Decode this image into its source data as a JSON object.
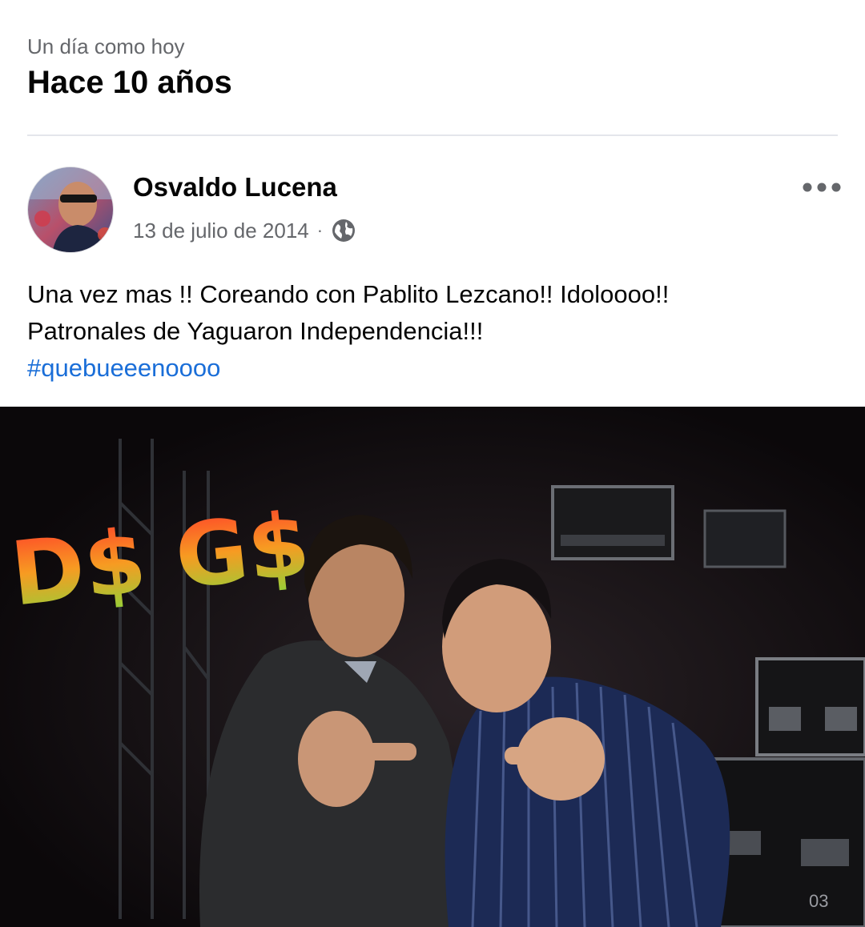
{
  "memory": {
    "eyebrow": "Un día como hoy",
    "title": "Hace 10 años"
  },
  "post": {
    "author": "Osvaldo Lucena",
    "date": "13 de julio de 2014",
    "separator": "·",
    "privacy_icon": "globe-icon",
    "more_icon": "more-options-icon",
    "text_line1": "Una vez mas !! Coreando con Pablito Lezcano!! Idoloooo!!",
    "text_line2": "Patronales de Yaguaron Independencia!!!",
    "hashtag": "#quebueeenoooo",
    "photo_overlay_text": "D$ G$",
    "photo_case_label": "03"
  },
  "colors": {
    "secondary_text": "#65676b",
    "primary_text": "#050505",
    "link": "#1a6ed8",
    "divider": "#e4e6eb",
    "photo_bg": "#0c0a0c"
  }
}
